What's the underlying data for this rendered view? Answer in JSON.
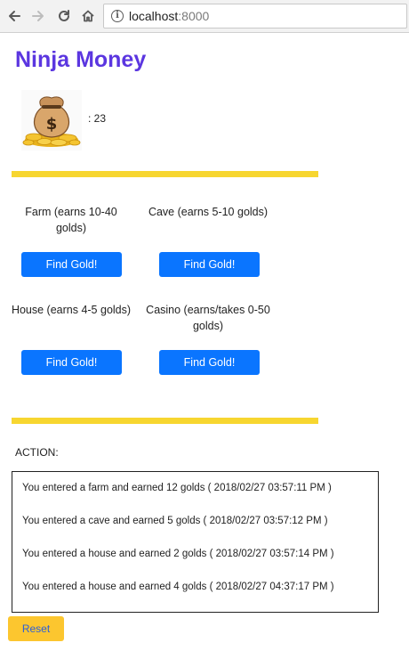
{
  "browser": {
    "url_host": "localhost",
    "url_port": ":8000",
    "icons": [
      "back-arrow-icon",
      "forward-arrow-icon",
      "reload-icon",
      "home-icon",
      "info-icon"
    ]
  },
  "page": {
    "title": "Ninja Money",
    "title_color": "#5b36e0",
    "gold_label": ": 23",
    "moneybag_icon": "money-bag-icon"
  },
  "places": [
    {
      "name": "Farm (earns 10-40 golds)",
      "button": "Find Gold!"
    },
    {
      "name": "Cave (earns 5-10 golds)",
      "button": "Find Gold!"
    },
    {
      "name": "House (earns 4-5 golds)",
      "button": "Find Gold!"
    },
    {
      "name": "Casino (earns/takes 0-50 golds)",
      "button": "Find Gold!"
    }
  ],
  "activity": {
    "label": "ACTION:",
    "entries": [
      "You entered a farm and earned 12 golds ( 2018/02/27 03:57:11 PM )",
      "You entered a cave and earned 5 golds ( 2018/02/27 03:57:12 PM )",
      "You entered a house and earned 2 golds ( 2018/02/27 03:57:14 PM )",
      "You entered a house and earned 4 golds ( 2018/02/27 04:37:17 PM )"
    ]
  },
  "reset_label": "Reset",
  "colors": {
    "accent_bar": "#f7d630",
    "find_button": "#0a75ff",
    "reset_button": "#fcc62f"
  }
}
